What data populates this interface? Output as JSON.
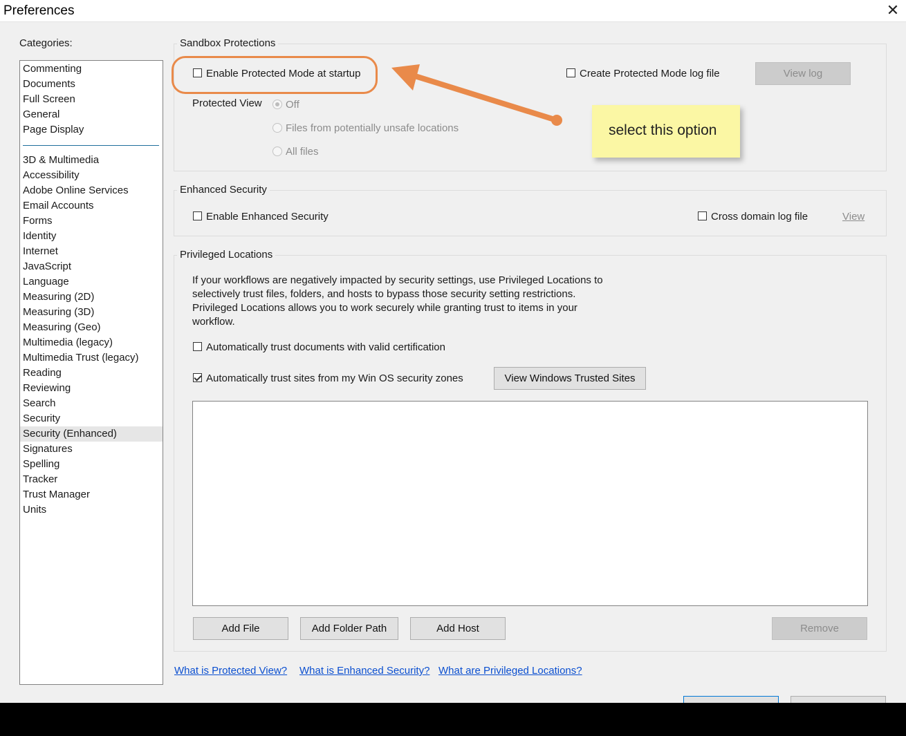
{
  "window": {
    "title": "Preferences",
    "close_glyph": "✕"
  },
  "categories": {
    "label": "Categories:",
    "pinned": [
      "Commenting",
      "Documents",
      "Full Screen",
      "General",
      "Page Display"
    ],
    "items": [
      "3D & Multimedia",
      "Accessibility",
      "Adobe Online Services",
      "Email Accounts",
      "Forms",
      "Identity",
      "Internet",
      "JavaScript",
      "Language",
      "Measuring (2D)",
      "Measuring (3D)",
      "Measuring (Geo)",
      "Multimedia (legacy)",
      "Multimedia Trust (legacy)",
      "Reading",
      "Reviewing",
      "Search",
      "Security",
      "Security (Enhanced)",
      "Signatures",
      "Spelling",
      "Tracker",
      "Trust Manager",
      "Units"
    ],
    "selected": "Security (Enhanced)"
  },
  "sandbox": {
    "title": "Sandbox Protections",
    "enable_protected_mode": {
      "label": "Enable Protected Mode at startup",
      "checked": false
    },
    "create_log": {
      "label": "Create Protected Mode log file",
      "checked": false
    },
    "view_log_button": "View log",
    "protected_view": {
      "label": "Protected View",
      "options": [
        "Off",
        "Files from potentially unsafe locations",
        "All files"
      ],
      "selected": "Off"
    }
  },
  "enhanced": {
    "title": "Enhanced Security",
    "enable": {
      "label": "Enable Enhanced Security",
      "checked": false
    },
    "cross_domain": {
      "label": "Cross domain log file",
      "checked": false
    },
    "view_link": "View"
  },
  "privileged": {
    "title": "Privileged Locations",
    "description": [
      "If your workflows are negatively impacted by security settings, use Privileged Locations to",
      "selectively trust files, folders, and hosts to bypass those security setting restrictions.",
      "Privileged Locations allows you to work securely while granting trust to items in your",
      "workflow."
    ],
    "trust_cert": {
      "label": "Automatically trust documents with valid certification",
      "checked": false
    },
    "trust_sites": {
      "label": "Automatically trust sites from my Win OS security zones",
      "checked": true
    },
    "view_sites_button": "View Windows Trusted Sites",
    "buttons": {
      "add_file": "Add File",
      "add_folder": "Add Folder Path",
      "add_host": "Add Host",
      "remove": "Remove"
    }
  },
  "help_links": [
    "What is Protected View?",
    "What is Enhanced Security?",
    "What are Privileged Locations?"
  ],
  "annotation": {
    "note": "select this option",
    "note_color": "#fbf7a4",
    "accent_color": "#e98a4a"
  }
}
